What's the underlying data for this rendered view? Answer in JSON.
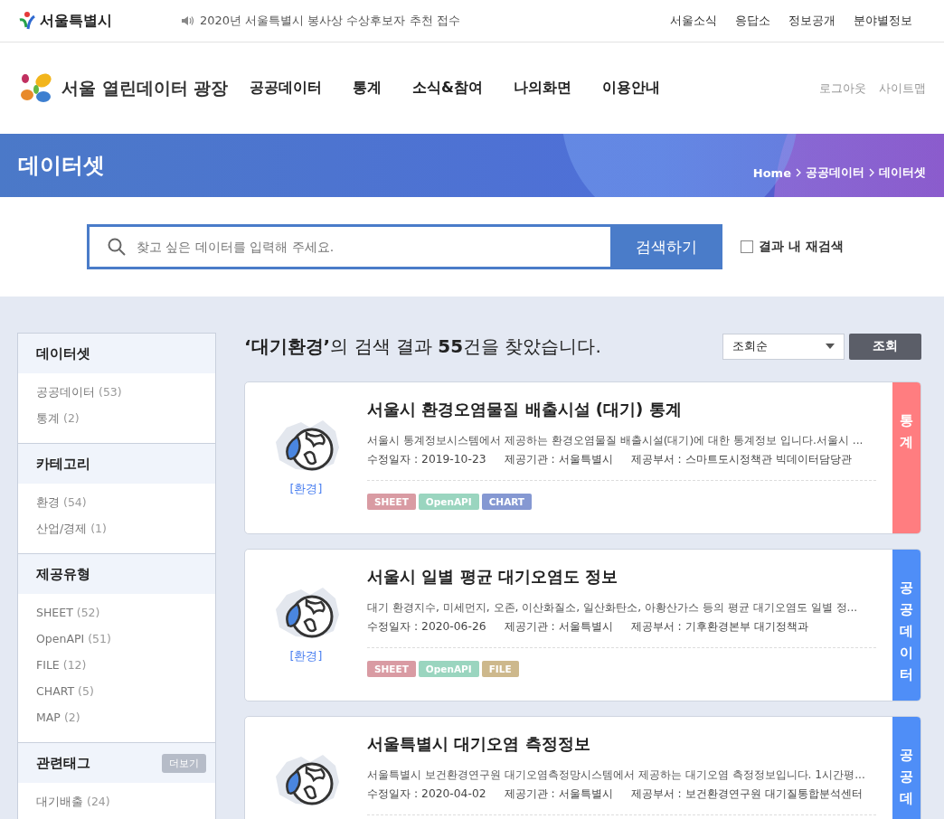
{
  "top_bar": {
    "logo_text": "서울특별시",
    "notice": "2020년 서울특별시 봉사상 수상후보자 추천 접수",
    "links": [
      "서울소식",
      "응답소",
      "정보공개",
      "분야별정보"
    ]
  },
  "header": {
    "site_title": "서울 열린데이터 광장",
    "nav": [
      "공공데이터",
      "통계",
      "소식&참여",
      "나의화면",
      "이용안내"
    ],
    "util_links": [
      "로그아웃",
      "사이트맵"
    ]
  },
  "banner": {
    "title": "데이터셋",
    "breadcrumb": [
      "Home",
      "공공데이터",
      "데이터셋"
    ]
  },
  "search": {
    "placeholder": "찾고 싶은 데이터를 입력해 주세요.",
    "button": "검색하기",
    "refine_label": "결과 내 재검색",
    "refine_checked": false
  },
  "sidebar": [
    {
      "title": "데이터셋",
      "items": [
        {
          "label": "공공데이터",
          "count": "(53)"
        },
        {
          "label": "통계",
          "count": "(2)"
        }
      ]
    },
    {
      "title": "카테고리",
      "items": [
        {
          "label": "환경",
          "count": "(54)"
        },
        {
          "label": "산업/경제",
          "count": "(1)"
        }
      ]
    },
    {
      "title": "제공유형",
      "items": [
        {
          "label": "SHEET",
          "count": "(52)"
        },
        {
          "label": "OpenAPI",
          "count": "(51)"
        },
        {
          "label": "FILE",
          "count": "(12)"
        },
        {
          "label": "CHART",
          "count": "(5)"
        },
        {
          "label": "MAP",
          "count": "(2)"
        }
      ]
    },
    {
      "title": "관련태그",
      "more_button": "더보기",
      "items": [
        {
          "label": "대기배출",
          "count": "(24)"
        }
      ]
    }
  ],
  "results": {
    "summary": "**‘대기환경’**의 검색 결과  **55**건을 찾았습니다.",
    "sort_select": "조회순",
    "button": "조회",
    "cards": [
      {
        "title": "서울시 환경오염물질 배출시설 (대기) 통계",
        "description": "서울시 통계정보시스템에서 제공하는 환경오염물질 배출시설(대기)에 대한 통계정보 입니다.서울시 ...",
        "meta": [
          {
            "label": "수정일자 :",
            "value": "2019-10-23"
          },
          {
            "label": "제공기관 :",
            "value": "서울특별시"
          },
          {
            "label": "제공부서 :",
            "value": "스마트도시정책관 빅데이터담당관"
          }
        ],
        "category": "[환경]",
        "formats": [
          {
            "label": "SHEET",
            "kind": "sheet"
          },
          {
            "label": "OpenAPI",
            "kind": "openapi"
          },
          {
            "label": "CHART",
            "kind": "chart"
          }
        ],
        "type_label": "통계",
        "color": "#ff7d80"
      },
      {
        "title": "서울시 일별 평균 대기오염도 정보",
        "description": "대기 환경지수, 미세먼지, 오존, 이산화질소, 일산화탄소, 아황산가스 등의 평균 대기오염도 일별 정...",
        "meta": [
          {
            "label": "수정일자 :",
            "value": "2020-06-26"
          },
          {
            "label": "제공기관 :",
            "value": "서울특별시"
          },
          {
            "label": "제공부서 :",
            "value": "기후환경본부 대기정책과"
          }
        ],
        "category": "[환경]",
        "formats": [
          {
            "label": "SHEET",
            "kind": "sheet"
          },
          {
            "label": "OpenAPI",
            "kind": "openapi"
          },
          {
            "label": "FILE",
            "kind": "file"
          }
        ],
        "type_label": "공공데이터",
        "color": "#4f8ef7"
      },
      {
        "title": "서울특별시 대기오염 측정정보",
        "description": "서울특별시 보건환경연구원 대기오염측정망시스템에서 제공하는 대기오염 측정정보입니다. 1시간평...",
        "meta": [
          {
            "label": "수정일자 :",
            "value": "2020-04-02"
          },
          {
            "label": "제공기관 :",
            "value": "서울특별시"
          },
          {
            "label": "제공부서 :",
            "value": "보건환경연구원 대기질통합분석센터"
          }
        ],
        "type_label": "공공데",
        "color": "#4f8ef7"
      }
    ]
  }
}
